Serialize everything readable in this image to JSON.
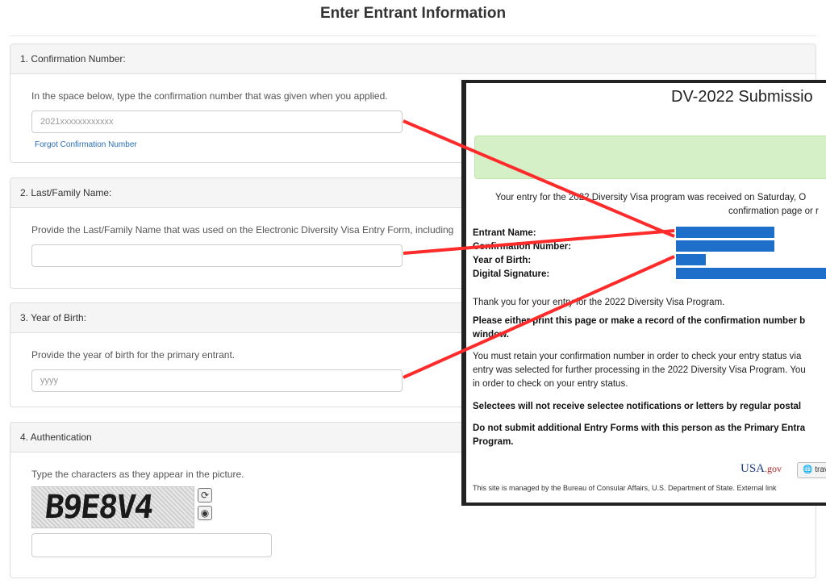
{
  "page": {
    "title": "Enter Entrant Information"
  },
  "sections": {
    "confirmation": {
      "heading": "1. Confirmation Number:",
      "instruction": "In the space below, type the confirmation number that was given when you applied.",
      "placeholder": "2021xxxxxxxxxxxx",
      "forgot_link": "Forgot Confirmation Number"
    },
    "last_name": {
      "heading": "2. Last/Family Name:",
      "instruction": "Provide the Last/Family Name that was used on the Electronic Diversity Visa Entry Form, including",
      "value": ""
    },
    "year_of_birth": {
      "heading": "3. Year of Birth:",
      "instruction": "Provide the year of birth for the primary entrant.",
      "placeholder": "yyyy"
    },
    "authentication": {
      "heading": "4. Authentication",
      "instruction": "Type the characters as they appear in the picture.",
      "captcha_text": "B9E8V4",
      "refresh_icon": "refresh-icon",
      "audio_icon": "audio-icon",
      "value": ""
    }
  },
  "overlay": {
    "title": "DV-2022 Submissio",
    "received_line1": "Your entry for the 2022 Diversity Visa program was received on Saturday, O",
    "received_line2": "confirmation page or r",
    "labels": {
      "entrant_name": "Entrant Name:",
      "confirmation_number": "Confirmation Number:",
      "year_of_birth": "Year of Birth:",
      "digital_signature": "Digital Signature:"
    },
    "thank_you": "Thank you for your entry for the 2022 Diversity Visa Program.",
    "print_line1": "Please either print this page or make a record of the confirmation number b",
    "print_line2": "window.",
    "retain_line1": "You must retain your confirmation number in order to check your entry status via",
    "retain_line2": "entry was selected for further processing in the 2022 Diversity Visa Program. You",
    "retain_line3": "in order to check on your entry status.",
    "selectees": "Selectees will not receive selectee notifications or letters by regular postal",
    "do_not_line1": "Do not submit additional Entry Forms with this person as the Primary Entra",
    "do_not_line2": "Program.",
    "usa_logo_main": "USA",
    "usa_logo_gov": ".gov",
    "travel_button": "trave",
    "footer": "This site is managed by the Bureau of Consular Affairs, U.S. Department of State. External link"
  },
  "colors": {
    "annotation_arrow": "#ff2a2a",
    "redaction": "#1e6fc9",
    "link": "#2a6fb8"
  }
}
